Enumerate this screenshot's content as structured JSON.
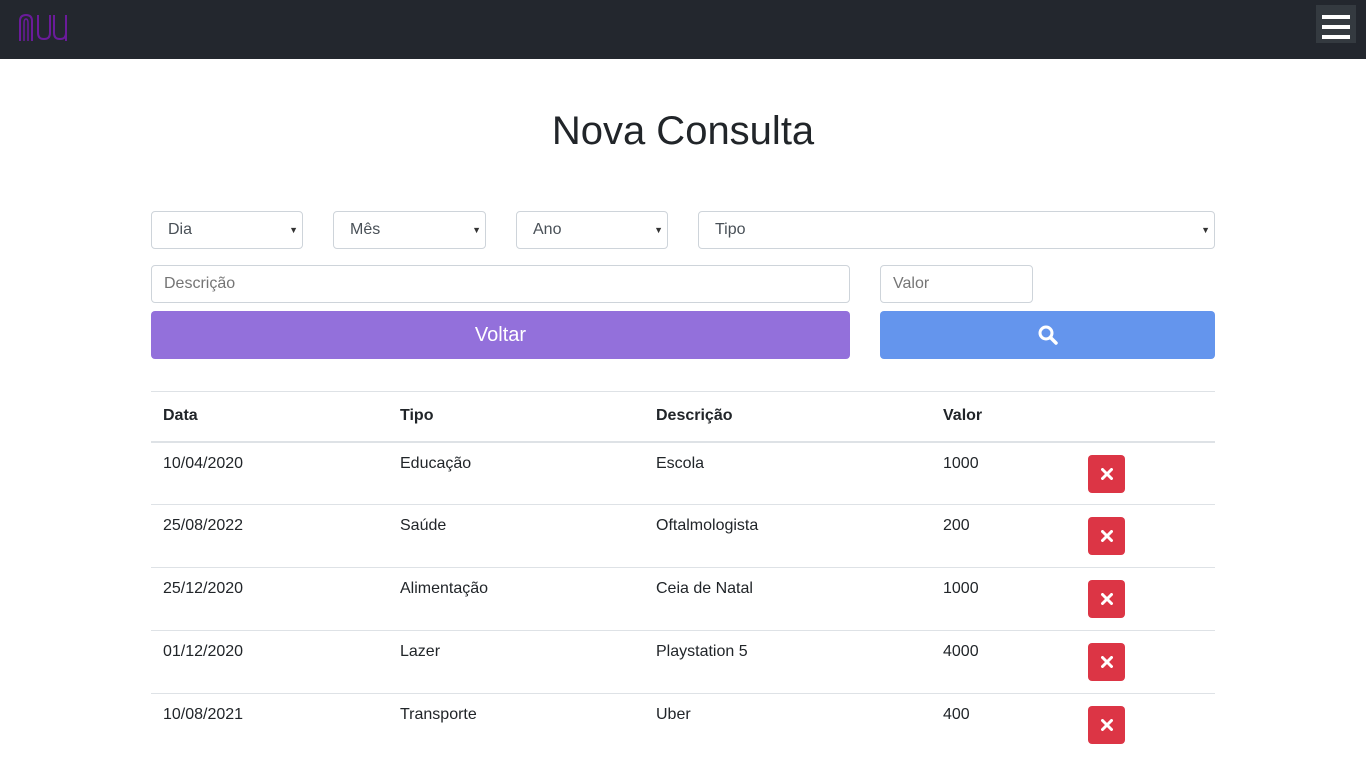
{
  "header": {
    "logo_icon": "nubank-logo-icon",
    "menu_icon": "hamburger-menu-icon"
  },
  "page": {
    "title": "Nova Consulta"
  },
  "filters": {
    "dia": "Dia",
    "mes": "Mês",
    "ano": "Ano",
    "tipo": "Tipo",
    "descricao_placeholder": "Descrição",
    "valor_placeholder": "Valor"
  },
  "buttons": {
    "voltar": "Voltar",
    "search_icon": "search-icon",
    "delete_icon": "close-icon"
  },
  "colors": {
    "navbar": "#23272e",
    "voltar": "#9370db",
    "search": "#6495ed",
    "delete": "#dc3545",
    "logo": "#820ad1"
  },
  "table": {
    "headers": [
      "Data",
      "Tipo",
      "Descrição",
      "Valor"
    ],
    "rows": [
      [
        "10/04/2020",
        "Educação",
        "Escola",
        "1000"
      ],
      [
        "25/08/2022",
        "Saúde",
        "Oftalmologista",
        "200"
      ],
      [
        "25/12/2020",
        "Alimentação",
        "Ceia de Natal",
        "1000"
      ],
      [
        "01/12/2020",
        "Lazer",
        "Playstation 5",
        "4000"
      ],
      [
        "10/08/2021",
        "Transporte",
        "Uber",
        "400"
      ]
    ]
  }
}
